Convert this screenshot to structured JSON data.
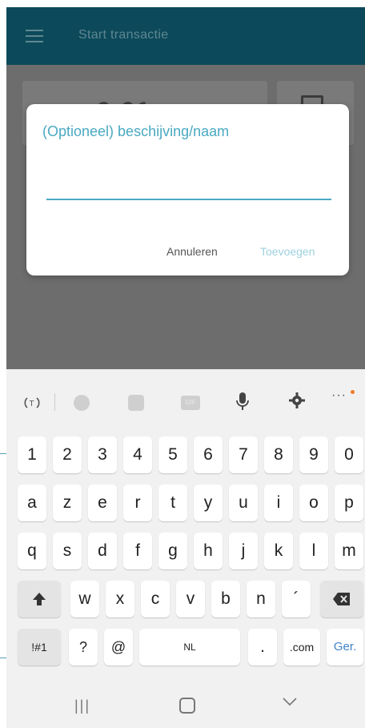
{
  "app_bar": {
    "title": "Start transactie"
  },
  "background": {
    "card_text": "0:01"
  },
  "dialog": {
    "title": "(Optioneel) beschijving/naam",
    "input_value": "",
    "cancel_label": "Annuleren",
    "add_label": "Toevoegen"
  },
  "keyboard": {
    "toolbar": {
      "gif_label": "GIF",
      "more_label": "···"
    },
    "row_numbers": [
      "1",
      "2",
      "3",
      "4",
      "5",
      "6",
      "7",
      "8",
      "9",
      "0"
    ],
    "row1": [
      "a",
      "z",
      "e",
      "r",
      "t",
      "y",
      "u",
      "i",
      "o",
      "p"
    ],
    "row2": [
      "q",
      "s",
      "d",
      "f",
      "g",
      "h",
      "j",
      "k",
      "l",
      "m"
    ],
    "row3": [
      "w",
      "x",
      "c",
      "v",
      "b",
      "n",
      "´"
    ],
    "bottom": {
      "symbols_label": "!#1",
      "question_label": "?",
      "at_label": "@",
      "space_label": "NL",
      "period_label": ".",
      "com_label": ".com",
      "go_label": "Ger."
    }
  },
  "nav": {
    "recent_label": "|||"
  },
  "colors": {
    "app_bar": "#0c4a5b",
    "accent": "#4aa9c2",
    "go": "#3d83c9",
    "notification_dot": "#f07a2a"
  }
}
